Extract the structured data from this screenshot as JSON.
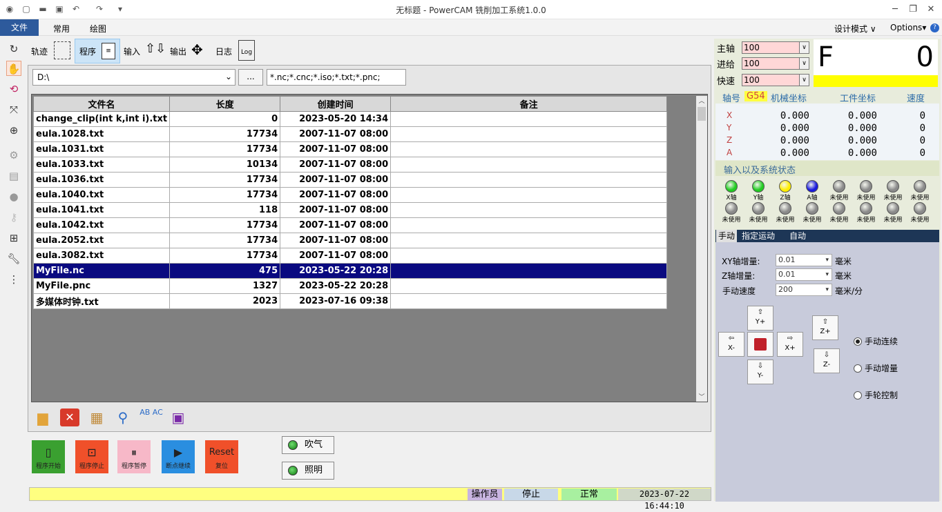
{
  "window": {
    "title": "无标题 - PowerCAM 铣削加工系统1.0.0"
  },
  "menubar": {
    "file": "文件",
    "common": "常用",
    "draw": "绘图",
    "design_mode": "设计模式",
    "options": "Options"
  },
  "subtoolbar": {
    "track": "轨迹",
    "program": "程序",
    "input": "输入",
    "output": "输出",
    "log": "日志",
    "log_icon": "Log"
  },
  "file_browser": {
    "path": "D:\\",
    "browse_label": "...",
    "filter": "*.nc;*.cnc;*.iso;*.txt;*.pnc;",
    "columns": [
      "文件名",
      "长度",
      "创建时间",
      "备注"
    ],
    "rows": [
      {
        "name": "change_clip(int k,int i).txt",
        "size": "0",
        "time": "2023-05-20 14:34",
        "note": ""
      },
      {
        "name": "eula.1028.txt",
        "size": "17734",
        "time": "2007-11-07 08:00",
        "note": ""
      },
      {
        "name": "eula.1031.txt",
        "size": "17734",
        "time": "2007-11-07 08:00",
        "note": ""
      },
      {
        "name": "eula.1033.txt",
        "size": "10134",
        "time": "2007-11-07 08:00",
        "note": ""
      },
      {
        "name": "eula.1036.txt",
        "size": "17734",
        "time": "2007-11-07 08:00",
        "note": ""
      },
      {
        "name": "eula.1040.txt",
        "size": "17734",
        "time": "2007-11-07 08:00",
        "note": ""
      },
      {
        "name": "eula.1041.txt",
        "size": "118",
        "time": "2007-11-07 08:00",
        "note": ""
      },
      {
        "name": "eula.1042.txt",
        "size": "17734",
        "time": "2007-11-07 08:00",
        "note": ""
      },
      {
        "name": "eula.2052.txt",
        "size": "17734",
        "time": "2007-11-07 08:00",
        "note": ""
      },
      {
        "name": "eula.3082.txt",
        "size": "17734",
        "time": "2007-11-07 08:00",
        "note": ""
      },
      {
        "name": "MyFile.nc",
        "size": "475",
        "time": "2023-05-22 20:28",
        "note": ""
      },
      {
        "name": "MyFile.pnc",
        "size": "1327",
        "time": "2023-05-22 20:28",
        "note": ""
      },
      {
        "name": "多媒体时钟.txt",
        "size": "2023",
        "time": "2023-07-16 09:38",
        "note": ""
      }
    ],
    "selected_row": 10,
    "rename_icon_text": "AB AC"
  },
  "control": {
    "start": "程序开始",
    "stop": "程序停止",
    "pause": "程序暂停",
    "resume": "断点继续",
    "reset_big": "Reset",
    "reset": "复位",
    "air": "吹气",
    "light": "照明"
  },
  "status": {
    "operator": "操作员",
    "state": "停止",
    "health": "正常",
    "datetime": "2023-07-22 16:44:10"
  },
  "machine": {
    "spindle_label": "主轴",
    "spindle_value": "100",
    "feed_label": "进给",
    "feed_value": "100",
    "rapid_label": "快速",
    "rapid_value": "100",
    "f_label": "F",
    "f_value": "0",
    "axis_header": "轴号",
    "wcs": "G54",
    "machine_coord": "机械坐标",
    "work_coord": "工件坐标",
    "speed": "速度",
    "axes": [
      {
        "name": "X",
        "machine": "0.000",
        "work": "0.000",
        "speed": "0"
      },
      {
        "name": "Y",
        "machine": "0.000",
        "work": "0.000",
        "speed": "0"
      },
      {
        "name": "Z",
        "machine": "0.000",
        "work": "0.000",
        "speed": "0"
      },
      {
        "name": "A",
        "machine": "0.000",
        "work": "0.000",
        "speed": "0"
      }
    ],
    "io_title": "输入以及系统状态",
    "io_row1": [
      {
        "label": "X轴",
        "color": "#22cc22"
      },
      {
        "label": "Y轴",
        "color": "#22cc22"
      },
      {
        "label": "Z轴",
        "color": "#ffee00"
      },
      {
        "label": "A轴",
        "color": "#1a1adc"
      },
      {
        "label": "未使用",
        "color": "#8a8a8a"
      },
      {
        "label": "未使用",
        "color": "#8a8a8a"
      },
      {
        "label": "未使用",
        "color": "#8a8a8a"
      },
      {
        "label": "未使用",
        "color": "#8a8a8a"
      }
    ],
    "io_row2_label": "未使用"
  },
  "manual": {
    "tabs": [
      "手动",
      "指定运动",
      "自动"
    ],
    "xy_inc_label": "XY轴增量:",
    "xy_inc": "0.01",
    "xy_unit": "毫米",
    "z_inc_label": "Z轴增量:",
    "z_inc": "0.01",
    "z_unit": "毫米",
    "speed_label": "手动速度",
    "speed": "200",
    "speed_unit": "毫米/分",
    "jog_yp": "Y+",
    "jog_yn": "Y-",
    "jog_xn": "X-",
    "jog_xp": "X+",
    "jog_zp": "Z+",
    "jog_zn": "Z-",
    "mode_cont": "手动连续",
    "mode_inc": "手动增量",
    "mode_wheel": "手轮控制"
  }
}
